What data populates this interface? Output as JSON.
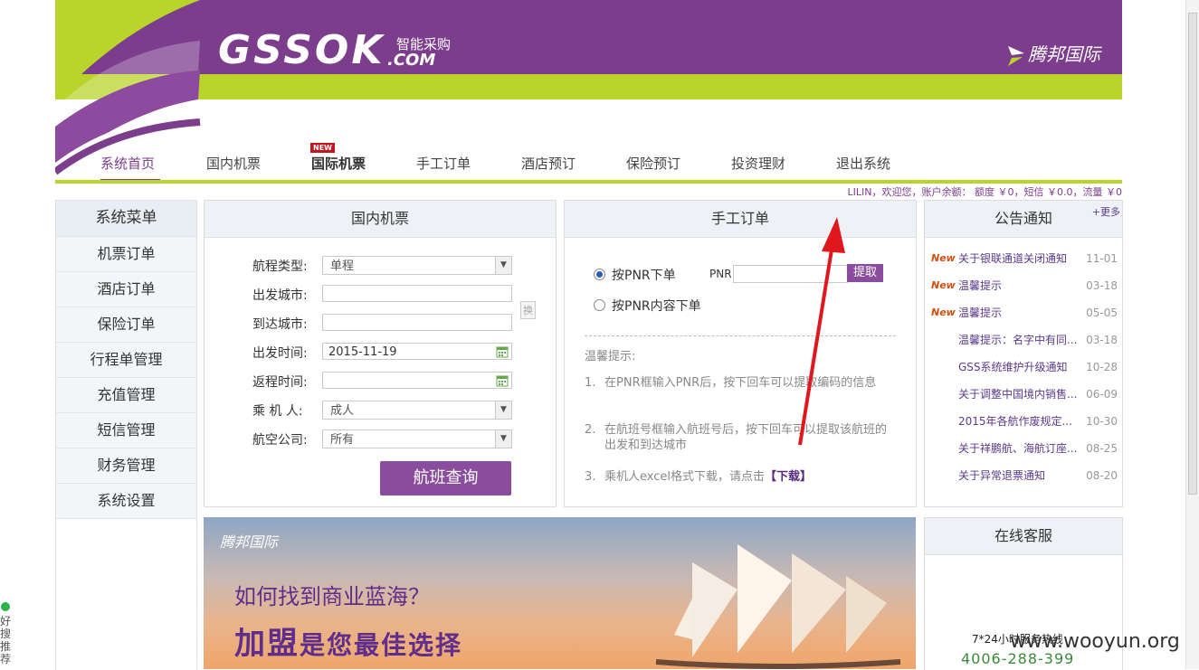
{
  "header": {
    "logo": "GSSOK",
    "logo_com": ".COM",
    "logo_cn": "智能采购",
    "brand": "腾邦国际"
  },
  "nav": {
    "items": [
      "系统首页",
      "国内机票",
      "国际机票",
      "手工订单",
      "酒店预订",
      "保险预订",
      "投资理财",
      "退出系统"
    ],
    "new_badge": "NEW"
  },
  "account": {
    "text": "LILIN，欢迎您，账户余额： 额度 ￥0，短信 ￥0.0，流量 ￥0"
  },
  "sidebar": {
    "title": "系统菜单",
    "items": [
      "机票订单",
      "酒店订单",
      "保险订单",
      "行程单管理",
      "充值管理",
      "短信管理",
      "财务管理",
      "系统设置"
    ]
  },
  "flight": {
    "title": "国内机票",
    "labels": {
      "route_type": "航程类型:",
      "from": "出发城市:",
      "to": "到达城市:",
      "depart": "出发时间:",
      "return": "返程时间:",
      "passenger": "乘 机 人:",
      "airline": "航空公司:"
    },
    "route_type_value": "单程",
    "depart_value": "2015-11-19",
    "passenger_value": "成人",
    "airline_value": "所有",
    "swap": "换",
    "search": "航班查询"
  },
  "manual": {
    "title": "手工订单",
    "option_pnr": "按PNR下单",
    "option_content": "按PNR内容下单",
    "pnr_label": "PNR",
    "fetch": "提取",
    "tips_title": "温馨提示:",
    "tips": [
      {
        "num": "1.",
        "text": "在PNR框输入PNR后，按下回车可以提取编码的信息"
      },
      {
        "num": "2.",
        "text": "在航班号框输入航班号后，按下回车可以提取该航班的出发和到达城市"
      },
      {
        "num": "3.",
        "text": "乘机人excel格式下载，请点击"
      }
    ],
    "download": "【下载】"
  },
  "notices": {
    "title": "公告通知",
    "more": "+更多",
    "new_label": "New",
    "items": [
      {
        "new": true,
        "title": "关于银联通道关闭通知",
        "date": "11-01"
      },
      {
        "new": true,
        "title": "温馨提示",
        "date": "03-18"
      },
      {
        "new": true,
        "title": "温馨提示",
        "date": "05-05"
      },
      {
        "new": false,
        "title": "温馨提示：名字中有同...",
        "date": "03-18"
      },
      {
        "new": false,
        "title": "GSS系统维护升级通知",
        "date": "10-28"
      },
      {
        "new": false,
        "title": "关于调整中国境内销售...",
        "date": "06-09"
      },
      {
        "new": false,
        "title": "2015年各航作废规定...",
        "date": "10-30"
      },
      {
        "new": false,
        "title": "关于祥鹏航、海航订座...",
        "date": "08-25"
      },
      {
        "new": false,
        "title": "关于异常退票通知",
        "date": "08-20"
      }
    ]
  },
  "service": {
    "title": "在线客服",
    "hotline_label": "7*24小时服务热线",
    "phone": "4006-288-399"
  },
  "banner": {
    "brand": "腾邦国际",
    "question": "如何找到商业蓝海？",
    "big_a": "加盟",
    "big_b": "是您最佳选择"
  },
  "watermark": "www.wooyun.org",
  "left_tool": "好搜推荐",
  "colors": {
    "purple": "#7d3d8d",
    "green": "#b9d42a",
    "red_arrow": "#e0181e"
  }
}
